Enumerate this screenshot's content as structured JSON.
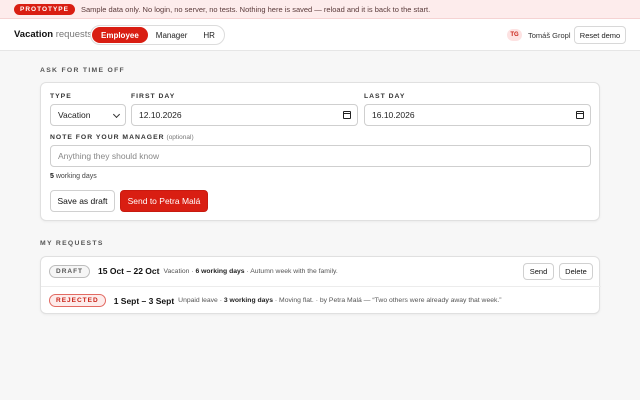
{
  "banner": {
    "badge": "PROTOTYPE",
    "text": "Sample data only. No login, no server, no tests. Nothing here is saved — reload and it is back to the start."
  },
  "header": {
    "brand_bold": "Vacation",
    "brand_rest": "requests",
    "roles": [
      "Employee",
      "Manager",
      "HR"
    ],
    "active_role": "Employee",
    "user_initials": "TG",
    "user_name": "Tomáš Gropl",
    "reset_label": "Reset demo"
  },
  "form": {
    "section_title": "ASK FOR TIME OFF",
    "type_label": "TYPE",
    "type_value": "Vacation",
    "first_day_label": "FIRST DAY",
    "first_day_value": "12.10.2026",
    "last_day_label": "LAST DAY",
    "last_day_value": "16.10.2026",
    "note_label": "NOTE FOR YOUR MANAGER",
    "note_optional": "(optional)",
    "note_placeholder": "Anything they should know",
    "working_days_count": "5",
    "working_days_text": "working days",
    "save_draft_label": "Save as draft",
    "send_label": "Send to Petra Malá"
  },
  "requests": {
    "section_title": "MY REQUESTS",
    "items": [
      {
        "status": "DRAFT",
        "dates": "15 Oct – 22 Oct",
        "type": "Vacation",
        "days": "6 working days",
        "note": "Autumn week with the family.",
        "send_label": "Send",
        "delete_label": "Delete"
      },
      {
        "status": "REJECTED",
        "dates": "1 Sept – 3 Sept",
        "type": "Unpaid leave",
        "days": "3 working days",
        "note": "Moving flat.",
        "decision": "by Petra Malá — “Two others were already away that week.”"
      }
    ]
  },
  "colors": {
    "accent": "#d91e12",
    "banner_bg": "#fdecec"
  }
}
